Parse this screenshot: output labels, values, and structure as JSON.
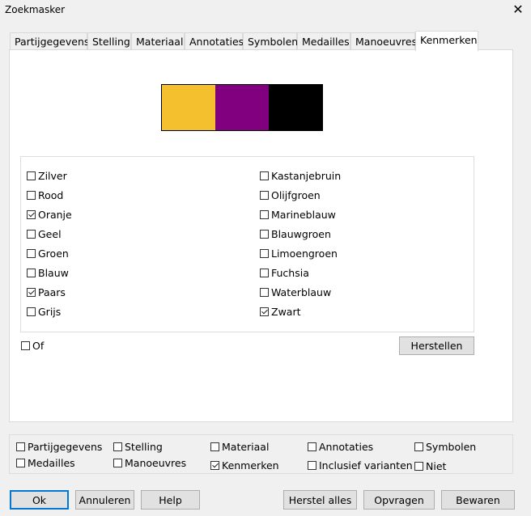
{
  "window": {
    "title": "Zoekmasker",
    "close_symbol": "✕"
  },
  "tabs": [
    {
      "label": "Partijgegevens"
    },
    {
      "label": "Stelling"
    },
    {
      "label": "Materiaal"
    },
    {
      "label": "Annotaties"
    },
    {
      "label": "Symbolen"
    },
    {
      "label": "Medailles"
    },
    {
      "label": "Manoeuvres"
    },
    {
      "label": "Kenmerken",
      "active": true
    }
  ],
  "colors_preview": [
    "#f5c02e",
    "#800080",
    "#000000"
  ],
  "colors": {
    "left": [
      {
        "label": "Zilver",
        "checked": false
      },
      {
        "label": "Rood",
        "checked": false
      },
      {
        "label": "Oranje",
        "checked": true
      },
      {
        "label": "Geel",
        "checked": false
      },
      {
        "label": "Groen",
        "checked": false
      },
      {
        "label": "Blauw",
        "checked": false
      },
      {
        "label": "Paars",
        "checked": true
      },
      {
        "label": "Grijs",
        "checked": false
      }
    ],
    "right": [
      {
        "label": "Kastanjebruin",
        "checked": false
      },
      {
        "label": "Olijfgroen",
        "checked": false
      },
      {
        "label": "Marineblauw",
        "checked": false
      },
      {
        "label": "Blauwgroen",
        "checked": false
      },
      {
        "label": "Limoengroen",
        "checked": false
      },
      {
        "label": "Fuchsia",
        "checked": false
      },
      {
        "label": "Waterblauw",
        "checked": false
      },
      {
        "label": "Zwart",
        "checked": true
      }
    ]
  },
  "of_option": {
    "label": "Of",
    "checked": false
  },
  "reset_button": "Herstellen",
  "filters": [
    {
      "label": "Partijgegevens",
      "checked": false
    },
    {
      "label": "Stelling",
      "checked": false
    },
    {
      "label": "Materiaal",
      "checked": false
    },
    {
      "label": "Annotaties",
      "checked": false
    },
    {
      "label": "Symbolen",
      "checked": false
    },
    {
      "label": "Medailles",
      "checked": false
    },
    {
      "label": "Manoeuvres",
      "checked": false
    },
    {
      "label": "Kenmerken",
      "checked": true
    },
    {
      "label": "Inclusief varianten",
      "checked": false
    },
    {
      "label": "Niet",
      "checked": false
    }
  ],
  "buttons": {
    "ok": "Ok",
    "cancel": "Annuleren",
    "help": "Help",
    "reset_all": "Herstel alles",
    "query": "Opvragen",
    "save": "Bewaren"
  }
}
